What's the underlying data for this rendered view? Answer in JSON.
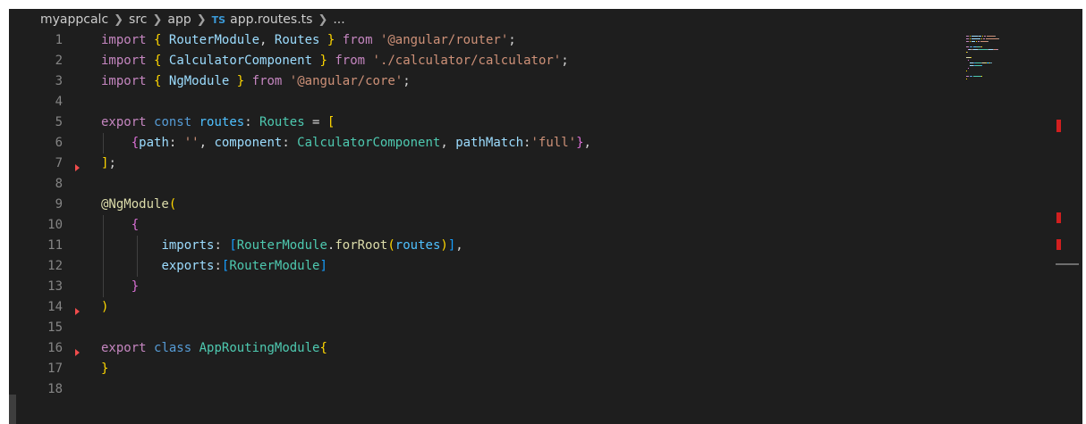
{
  "breadcrumb": {
    "items": [
      "myappcalc",
      "src",
      "app"
    ],
    "file_icon": "TS",
    "file": "app.routes.ts",
    "trailing": "..."
  },
  "code": {
    "line_numbers": [
      "1",
      "2",
      "3",
      "4",
      "5",
      "6",
      "7",
      "8",
      "9",
      "10",
      "11",
      "12",
      "13",
      "14",
      "15",
      "16",
      "17",
      "18"
    ],
    "lines": [
      [
        [
          "kw",
          "import"
        ],
        [
          "pl",
          " "
        ],
        [
          "b1",
          "{"
        ],
        [
          "pl",
          " "
        ],
        [
          "prop",
          "RouterModule"
        ],
        [
          "pl",
          ", "
        ],
        [
          "prop",
          "Routes"
        ],
        [
          "pl",
          " "
        ],
        [
          "b1",
          "}"
        ],
        [
          "pl",
          " "
        ],
        [
          "kw",
          "from"
        ],
        [
          "pl",
          " "
        ],
        [
          "str",
          "'@angular/router'"
        ],
        [
          "pl",
          ";"
        ]
      ],
      [
        [
          "kw",
          "import"
        ],
        [
          "pl",
          " "
        ],
        [
          "b1",
          "{"
        ],
        [
          "pl",
          " "
        ],
        [
          "prop",
          "CalculatorComponent"
        ],
        [
          "pl",
          " "
        ],
        [
          "b1",
          "}"
        ],
        [
          "pl",
          " "
        ],
        [
          "kw",
          "from"
        ],
        [
          "pl",
          " "
        ],
        [
          "str",
          "'./calculator/calculator'"
        ],
        [
          "pl",
          ";"
        ]
      ],
      [
        [
          "kw",
          "import"
        ],
        [
          "pl",
          " "
        ],
        [
          "b1",
          "{"
        ],
        [
          "pl",
          " "
        ],
        [
          "prop",
          "NgModule"
        ],
        [
          "pl",
          " "
        ],
        [
          "b1",
          "}"
        ],
        [
          "pl",
          " "
        ],
        [
          "kw",
          "from"
        ],
        [
          "pl",
          " "
        ],
        [
          "str",
          "'@angular/core'"
        ],
        [
          "pl",
          ";"
        ]
      ],
      [],
      [
        [
          "kw",
          "export"
        ],
        [
          "pl",
          " "
        ],
        [
          "st",
          "const"
        ],
        [
          "pl",
          " "
        ],
        [
          "var",
          "routes"
        ],
        [
          "pl",
          ": "
        ],
        [
          "cls",
          "Routes"
        ],
        [
          "pl",
          " = "
        ],
        [
          "b1",
          "["
        ]
      ],
      [
        [
          "pl",
          "    "
        ],
        [
          "b2",
          "{"
        ],
        [
          "prop",
          "path"
        ],
        [
          "pl",
          ": "
        ],
        [
          "str",
          "''"
        ],
        [
          "pl",
          ", "
        ],
        [
          "prop",
          "component"
        ],
        [
          "pl",
          ": "
        ],
        [
          "cls",
          "CalculatorComponent"
        ],
        [
          "pl",
          ", "
        ],
        [
          "prop",
          "pathMatch"
        ],
        [
          "pl",
          ":"
        ],
        [
          "str",
          "'full'"
        ],
        [
          "b2",
          "}"
        ],
        [
          "pl",
          ","
        ]
      ],
      [
        [
          "b1",
          "]"
        ],
        [
          "pl",
          ";"
        ]
      ],
      [],
      [
        [
          "fn",
          "@NgModule"
        ],
        [
          "b1",
          "("
        ]
      ],
      [
        [
          "pl",
          "    "
        ],
        [
          "b2",
          "{"
        ]
      ],
      [
        [
          "pl",
          "        "
        ],
        [
          "prop",
          "imports"
        ],
        [
          "pl",
          ": "
        ],
        [
          "b3",
          "["
        ],
        [
          "cls",
          "RouterModule"
        ],
        [
          "pl",
          "."
        ],
        [
          "fn",
          "forRoot"
        ],
        [
          "b1",
          "("
        ],
        [
          "var",
          "routes"
        ],
        [
          "b1",
          ")"
        ],
        [
          "b3",
          "]"
        ],
        [
          "pl",
          ","
        ]
      ],
      [
        [
          "pl",
          "        "
        ],
        [
          "prop",
          "exports"
        ],
        [
          "pl",
          ":"
        ],
        [
          "b3",
          "["
        ],
        [
          "cls",
          "RouterModule"
        ],
        [
          "b3",
          "]"
        ]
      ],
      [
        [
          "pl",
          "    "
        ],
        [
          "b2",
          "}"
        ]
      ],
      [
        [
          "b1",
          ")"
        ]
      ],
      [],
      [
        [
          "kw",
          "export"
        ],
        [
          "pl",
          " "
        ],
        [
          "st",
          "class"
        ],
        [
          "pl",
          " "
        ],
        [
          "cls",
          "AppRoutingModule"
        ],
        [
          "b1",
          "{"
        ]
      ],
      [
        [
          "b1",
          "}"
        ]
      ],
      []
    ],
    "error_glyph_lines": [
      7,
      14,
      16
    ]
  },
  "colors": {
    "background": "#1e1e1e",
    "error": "#d11f1f"
  }
}
